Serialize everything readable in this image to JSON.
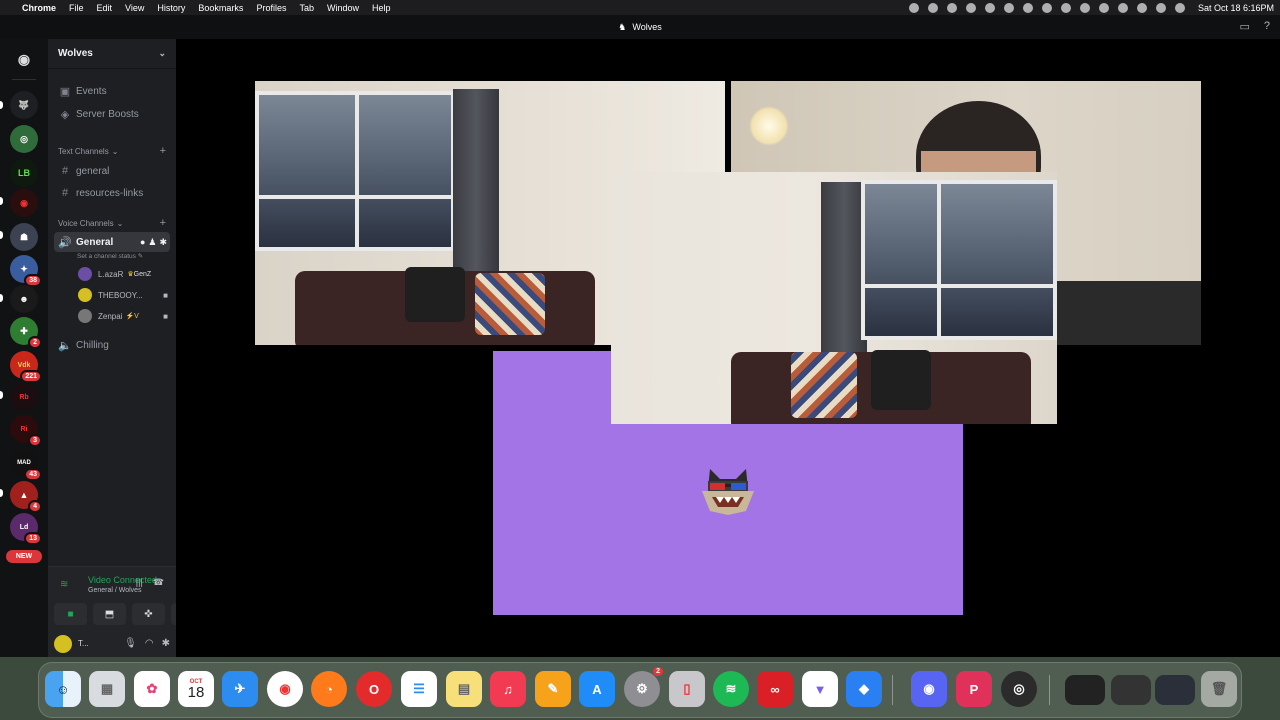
{
  "menubar": {
    "app": "Chrome",
    "items": [
      "File",
      "Edit",
      "View",
      "History",
      "Bookmarks",
      "Profiles",
      "Tab",
      "Window",
      "Help"
    ],
    "clock": "Sat Oct 18  6:16PM"
  },
  "window": {
    "title": "Wolves"
  },
  "guilds": {
    "badges": [
      "38",
      "2",
      "221",
      "3",
      "43",
      "4",
      "13"
    ],
    "new_label": "NEW"
  },
  "server": {
    "name": "Wolves",
    "events": "Events",
    "boosts": "Server Boosts",
    "text_category": "Text Channels",
    "text_channels": [
      "general",
      "resources-links"
    ],
    "voice_category": "Voice Channels",
    "active_voice": "General",
    "status_prompt": "Set a channel status",
    "members": [
      {
        "name": "L.azaR",
        "tag": "GenZ"
      },
      {
        "name": "THEBOOY...",
        "tag": ""
      },
      {
        "name": "Zenpai",
        "tag": "⚡V"
      }
    ],
    "other_voice": "Chilling"
  },
  "voice_connection": {
    "status": "Video Connected",
    "location": "General / Wolves"
  },
  "user": {
    "name": "T..."
  },
  "accent": "#a374e6",
  "dock": {
    "calendar_month": "OCT",
    "calendar_day": "18",
    "settings_badge": "2"
  }
}
